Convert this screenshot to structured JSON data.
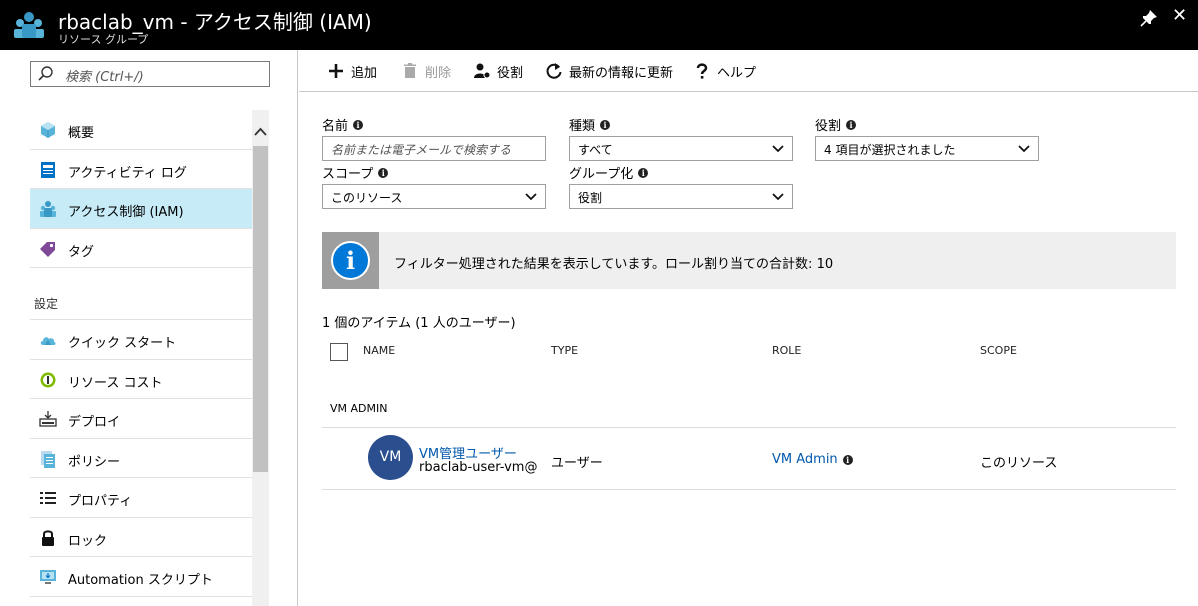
{
  "window": {
    "title": "rbaclab_vm - アクセス制御 (IAM)",
    "subtitle": "リソース グループ",
    "close_label": "✕"
  },
  "sidebar": {
    "search_placeholder": "検索 (Ctrl+/)",
    "items_top": [
      {
        "label": "概要",
        "icon": "overview-cube-icon"
      },
      {
        "label": "アクティビティ ログ",
        "icon": "activity-log-icon"
      },
      {
        "label": "アクセス制御 (IAM)",
        "icon": "iam-users-icon",
        "selected": true
      },
      {
        "label": "タグ",
        "icon": "tag-icon"
      }
    ],
    "section_label": "設定",
    "items_settings": [
      {
        "label": "クイック スタート",
        "icon": "cloud-icon"
      },
      {
        "label": "リソース コスト",
        "icon": "cost-icon"
      },
      {
        "label": "デプロイ",
        "icon": "deploy-icon"
      },
      {
        "label": "ポリシー",
        "icon": "policy-icon"
      },
      {
        "label": "プロパティ",
        "icon": "properties-icon"
      },
      {
        "label": "ロック",
        "icon": "lock-icon"
      },
      {
        "label": "Automation スクリプト",
        "icon": "automation-icon"
      }
    ]
  },
  "toolbar": {
    "add_label": "追加",
    "delete_label": "削除",
    "roles_label": "役割",
    "refresh_label": "最新の情報に更新",
    "help_label": "ヘルプ"
  },
  "filters": {
    "name_label": "名前",
    "name_placeholder": "名前または電子メールで検索する",
    "type_label": "種類",
    "type_value": "すべて",
    "role_label": "役割",
    "role_value": "4 項目が選択されました",
    "scope_label": "スコープ",
    "scope_value": "このリソース",
    "group_label": "グループ化",
    "group_value": "役割"
  },
  "info": {
    "message": "フィルター処理された結果を表示しています。ロール割り当ての合計数: 10",
    "icon_glyph": "i"
  },
  "results": {
    "count_text": "1 個のアイテム (1 人のユーザー)",
    "columns": [
      "NAME",
      "TYPE",
      "ROLE",
      "SCOPE"
    ],
    "group_name": "VM ADMIN",
    "rows": [
      {
        "avatar": "VM",
        "name": "VM管理ユーザー",
        "email": "rbaclab-user-vm@",
        "type": "ユーザー",
        "role": "VM Admin",
        "scope": "このリソース"
      }
    ]
  },
  "colors": {
    "selected_bg": "#c7ecf8",
    "accent": "#0078d7",
    "link": "#0058ad",
    "avatar_bg": "#2a4e8e"
  }
}
